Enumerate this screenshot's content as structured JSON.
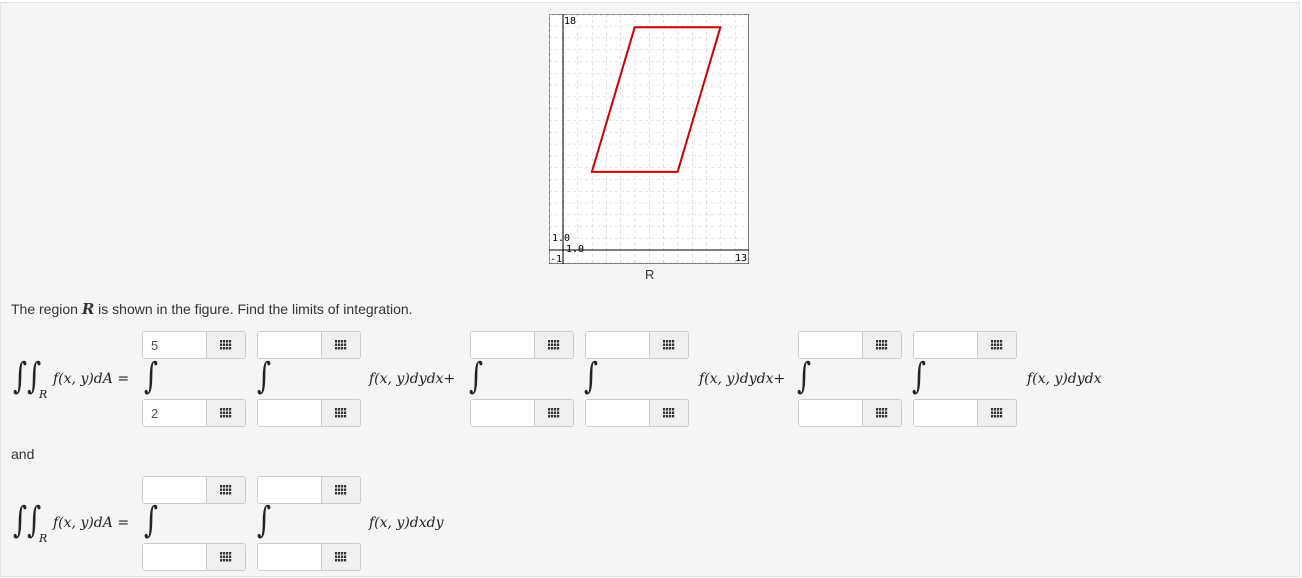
{
  "figure": {
    "labels": {
      "top": "18",
      "corner_y": "1.0",
      "corner_x": "1.0",
      "left": "-1",
      "right": "13"
    },
    "caption": "R",
    "region_color": "#cc0000",
    "region_vertices": [
      [
        2,
        6
      ],
      [
        8,
        6
      ],
      [
        11,
        17
      ],
      [
        5,
        17
      ]
    ],
    "x_range": [
      -1,
      13
    ],
    "y_range": [
      -1,
      18
    ],
    "grid": true
  },
  "prompt": {
    "before": "The region ",
    "var": "R",
    "after": " is shown in the figure. Find the limits of integration."
  },
  "and_text": "and",
  "math": {
    "lhs": "f(x, y)dA =",
    "sub_r": "R",
    "term_plus": "f(x, y)dydx+",
    "term_end": "f(x, y)dydx",
    "term_dxdy": "f(x, y)dxdy"
  },
  "inputs": {
    "r1_a_upper": "5",
    "r1_a_lower": "2",
    "r1_b_upper": "",
    "r1_b_lower": "",
    "r1_c_upper": "",
    "r1_c_lower": "",
    "r1_d_upper": "",
    "r1_d_lower": "",
    "r1_e_upper": "",
    "r1_e_lower": "",
    "r1_f_upper": "",
    "r1_f_lower": "",
    "r2_a_upper": "",
    "r2_a_lower": "",
    "r2_b_upper": "",
    "r2_b_lower": ""
  },
  "icons": {
    "palette": "grid-icon"
  }
}
